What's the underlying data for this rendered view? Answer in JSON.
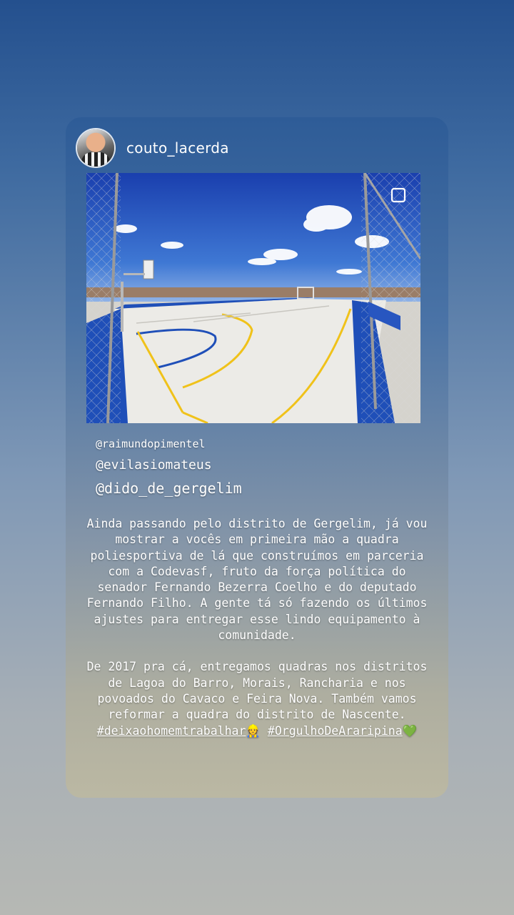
{
  "story": {
    "username": "couto_lacerda",
    "mentions": [
      "@raimundopimentel",
      "@evilasiomateus",
      "@dido_de_gergelim"
    ],
    "paragraph1": "Ainda passando pelo distrito de Gergelim, já vou mostrar a vocês em primeira mão a quadra poliesportiva de lá que construímos em parceria com a Codevasf, fruto da força política do senador Fernando Bezerra Coelho e do deputado Fernando Filho. A gente tá só fazendo os últimos ajustes para entregar esse lindo equipamento à comunidade.",
    "paragraph2_text": "De 2017 pra cá, entregamos quadras nos distritos de Lagoa do Barro, Morais, Rancharia e nos povoados do Cavaco e Feira Nova. Também vamos reformar a quadra do distrito de Nascente.",
    "hashtag1": "#deixaohomemtrabalhar",
    "emoji1": "👷",
    "hashtag2": "#OrgulhoDeAraripina",
    "emoji2": "💚"
  },
  "icons": {
    "avatar": "profile-photo",
    "photo": "sports-court-photo"
  },
  "colors": {
    "mention_highlight": "#57c46a",
    "court_blue": "#1f4fb8",
    "court_yellow": "#f0c21a"
  }
}
